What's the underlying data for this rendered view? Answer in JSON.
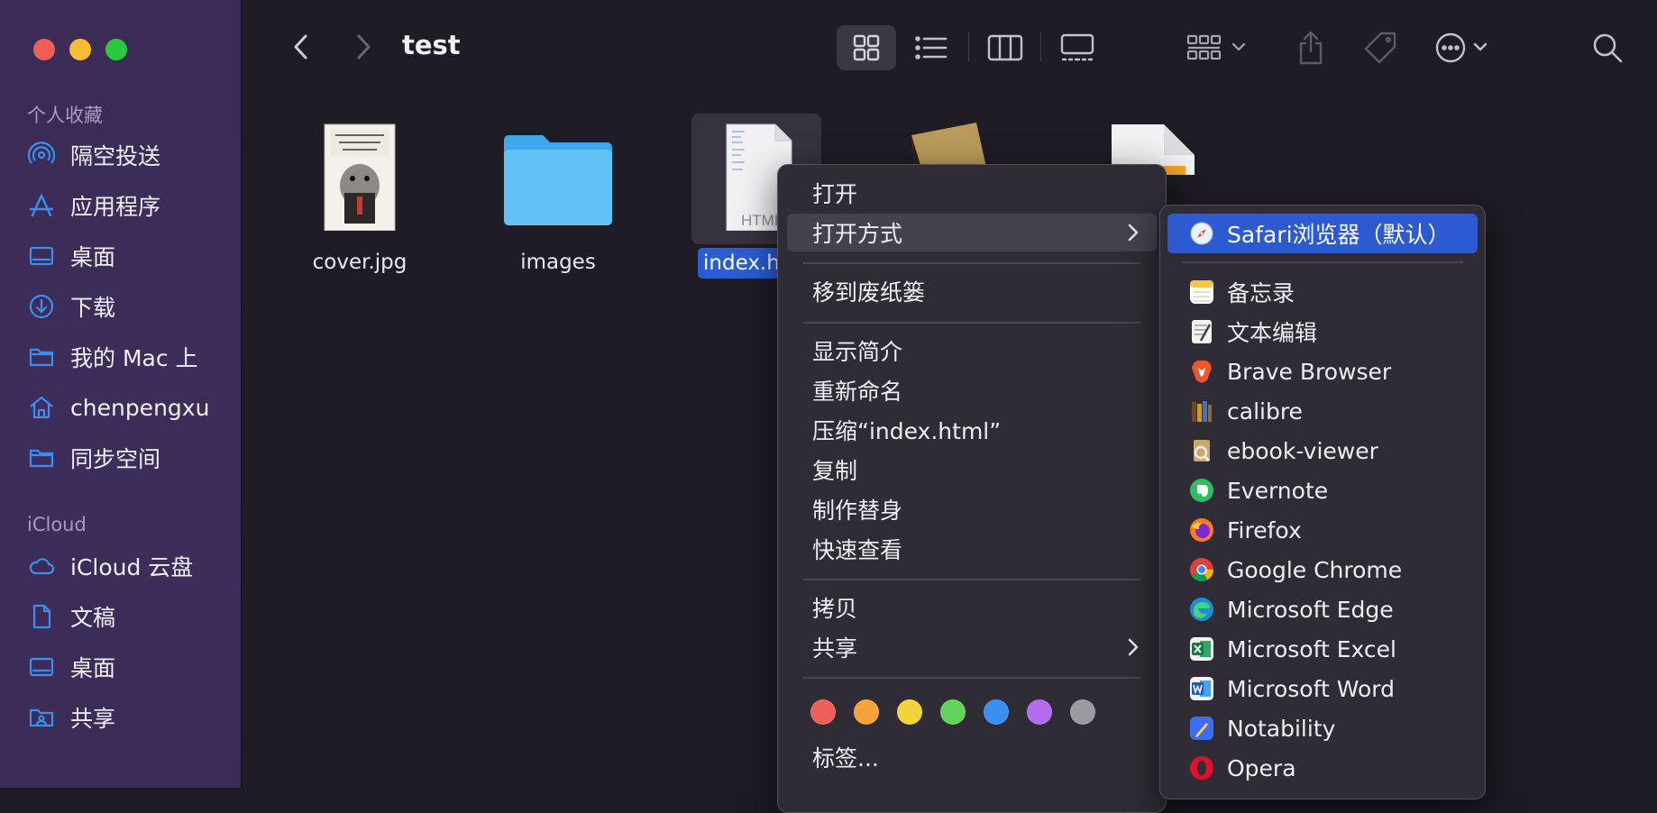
{
  "window": {
    "title": "test"
  },
  "sidebar": {
    "favorites_header": "个人收藏",
    "favorites": [
      {
        "label": "隔空投送",
        "icon": "airdrop-icon"
      },
      {
        "label": "应用程序",
        "icon": "applications-icon"
      },
      {
        "label": "桌面",
        "icon": "desktop-icon"
      },
      {
        "label": "下载",
        "icon": "downloads-icon"
      },
      {
        "label": "我的 Mac 上",
        "icon": "folder-icon"
      },
      {
        "label": "chenpengxu",
        "icon": "home-icon"
      },
      {
        "label": "同步空间",
        "icon": "folder-icon"
      }
    ],
    "icloud_header": "iCloud",
    "icloud": [
      {
        "label": "iCloud 云盘",
        "icon": "cloud-icon"
      },
      {
        "label": "文稿",
        "icon": "document-icon"
      },
      {
        "label": "桌面",
        "icon": "desktop-icon"
      },
      {
        "label": "共享",
        "icon": "shared-folder-icon"
      }
    ]
  },
  "files": [
    {
      "name": "cover.jpg",
      "kind": "image"
    },
    {
      "name": "images",
      "kind": "folder"
    },
    {
      "name": "index.h",
      "kind": "html",
      "selected": true,
      "badge": "HTML"
    }
  ],
  "context_menu": {
    "items": {
      "open": "打开",
      "open_with": "打开方式",
      "move_to_trash": "移到废纸篓",
      "get_info": "显示简介",
      "rename": "重新命名",
      "compress": "压缩“index.html”",
      "duplicate": "复制",
      "make_alias": "制作替身",
      "quick_look": "快速查看",
      "copy": "拷贝",
      "share": "共享",
      "tags": "标签..."
    },
    "tag_colors": [
      "#f0605a",
      "#f5a33a",
      "#f2d43a",
      "#5fd35a",
      "#3b8ff0",
      "#b36cf0",
      "#9c9aa0"
    ]
  },
  "open_with_menu": {
    "default": "Safari浏览器（默认）",
    "apps": [
      "备忘录",
      "文本编辑",
      "Brave Browser",
      "calibre",
      "ebook-viewer",
      "Evernote",
      "Firefox",
      "Google Chrome",
      "Microsoft Edge",
      "Microsoft Excel",
      "Microsoft Word",
      "Notability",
      "Opera"
    ]
  }
}
